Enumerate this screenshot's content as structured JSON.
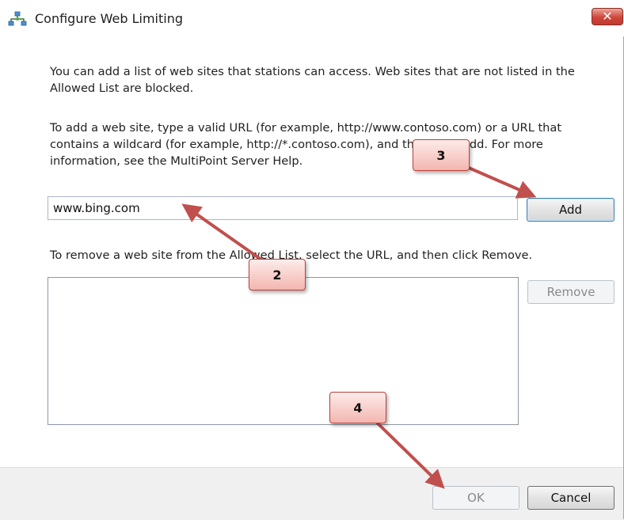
{
  "window": {
    "title": "Configure Web Limiting",
    "close_label": "✕"
  },
  "intro_text": "You can add a list of web sites that stations can access. Web sites that are not listed in the Allowed List are blocked.",
  "add_instructions": "To add a web site, type a valid URL (for example, http://www.contoso.com) or a URL that contains a wildcard (for example, http://*.contoso.com), and then click Add. For more information, see the MultiPoint Server Help.",
  "url_input": {
    "value": "www.bing.com",
    "placeholder": ""
  },
  "add_button": "Add",
  "remove_instructions": "To remove a web site from the Allowed List, select the URL, and then click Remove.",
  "allowed_list": {
    "items": []
  },
  "remove_button": "Remove",
  "footer": {
    "ok_label": "OK",
    "cancel_label": "Cancel"
  },
  "callouts": [
    "2",
    "3",
    "4"
  ],
  "colors": {
    "callout_border": "#b9423a",
    "callout_fill": "#f3b6b0",
    "arrow": "#c0504d",
    "close_button": "#d0453a"
  },
  "icons": {
    "title": "network-icon",
    "close": "close-icon"
  }
}
